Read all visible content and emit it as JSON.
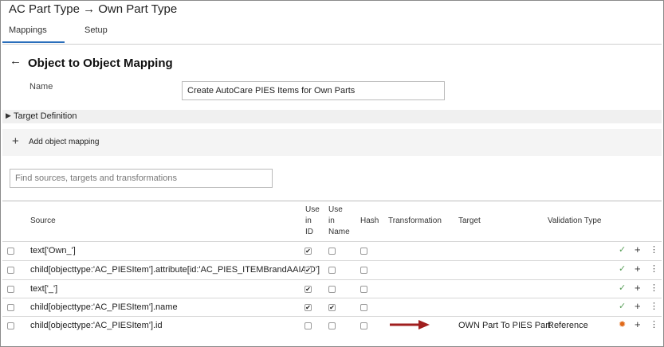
{
  "header": {
    "title": "AC Part Type → Own Part Type"
  },
  "tabs": [
    {
      "label": "Mappings",
      "active": true
    },
    {
      "label": "Setup",
      "active": false
    }
  ],
  "page": {
    "back_icon": "←",
    "title": "Object to Object Mapping"
  },
  "form": {
    "name_label": "Name",
    "name_value": "Create AutoCare PIES Items for Own Parts"
  },
  "sections": {
    "target_definition": "Target Definition",
    "add_object_mapping": "Add object mapping"
  },
  "search": {
    "placeholder": "Find sources, targets and transformations"
  },
  "table": {
    "headers": {
      "source": "Source",
      "use_in_id": [
        "Use",
        "in",
        "ID"
      ],
      "use_in_name": [
        "Use",
        "in",
        "Name"
      ],
      "hash": "Hash",
      "transformation": "Transformation",
      "target": "Target",
      "validation_type": "Validation Type"
    },
    "rows": [
      {
        "selected": false,
        "source": "text['Own_']",
        "use_in_id": true,
        "use_in_name": false,
        "hash": false,
        "transformation": "",
        "target": "",
        "validation_type": "",
        "status_icon": "check-icon"
      },
      {
        "selected": false,
        "source": "child[objecttype:'AC_PIESItem'].attribute[id:'AC_PIES_ITEMBrandAAIAID']",
        "use_in_id": true,
        "use_in_name": false,
        "hash": false,
        "transformation": "",
        "target": "",
        "validation_type": "",
        "status_icon": "check-icon"
      },
      {
        "selected": false,
        "source": "text['_']",
        "use_in_id": true,
        "use_in_name": false,
        "hash": false,
        "transformation": "",
        "target": "",
        "validation_type": "",
        "status_icon": "check-icon"
      },
      {
        "selected": false,
        "source": "child[objecttype:'AC_PIESItem'].name",
        "use_in_id": true,
        "use_in_name": true,
        "hash": false,
        "transformation": "",
        "target": "",
        "validation_type": "",
        "status_icon": "check-icon"
      },
      {
        "selected": false,
        "source": "child[objecttype:'AC_PIESItem'].id",
        "use_in_id": false,
        "use_in_name": false,
        "hash": false,
        "transformation": "",
        "target": "OWN Part To PIES Part",
        "validation_type": "Reference",
        "status_icon": "warning-icon"
      }
    ]
  },
  "colors": {
    "accent": "#2a6ebb",
    "ok": "#5aa05a",
    "warning": "#e06a1a",
    "arrow": "#a01f1f"
  }
}
